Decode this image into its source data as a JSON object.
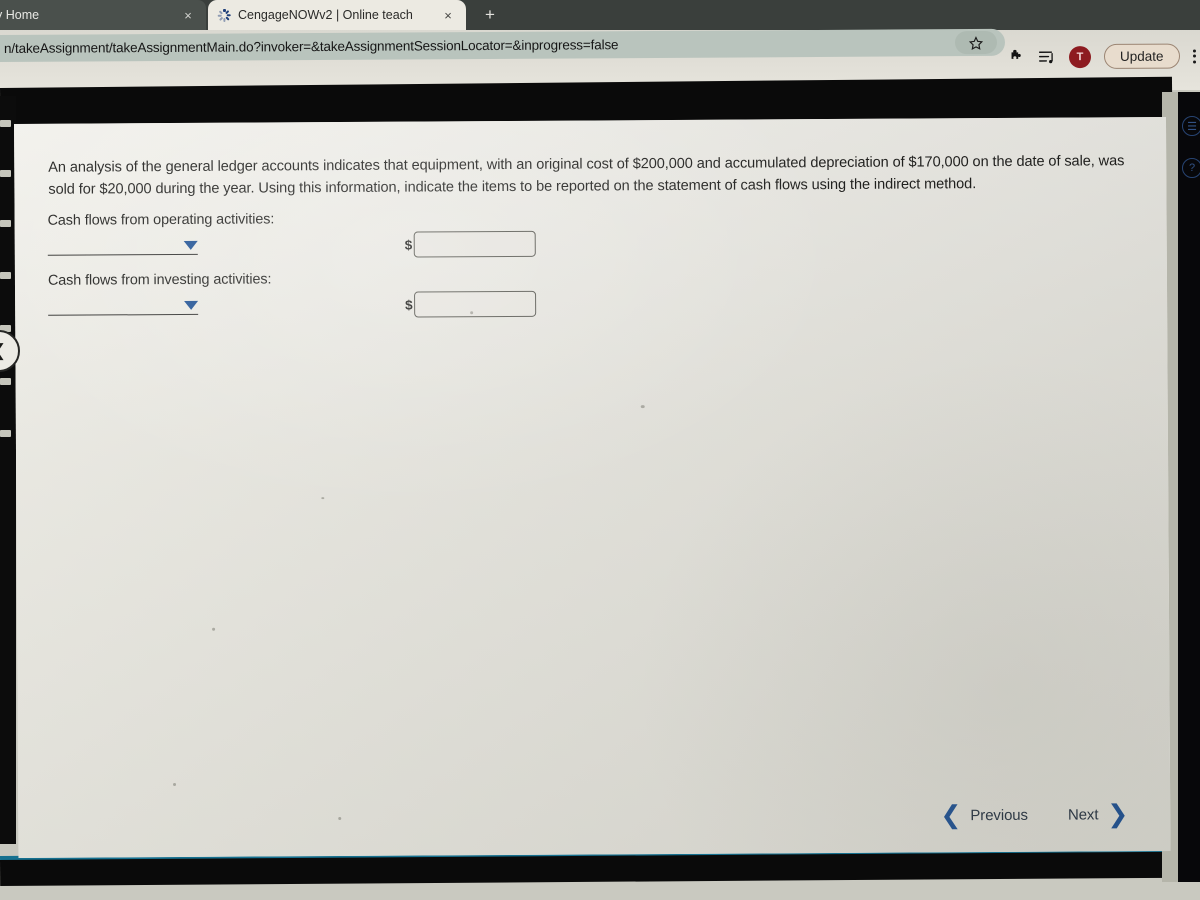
{
  "browser": {
    "tabs": [
      {
        "title": "y Home",
        "active": false,
        "close_label": "×",
        "loading": false
      },
      {
        "title": "CengageNOWv2 | Online teach",
        "active": true,
        "close_label": "×",
        "loading": true
      }
    ],
    "new_tab_label": "+",
    "url": "n/takeAssignment/takeAssignmentMain.do?invoker=&takeAssignmentSessionLocator=&inprogress=false",
    "bookmark_icon": "star-icon",
    "extensions_icon": "puzzle-piece-icon",
    "media_icon": "media-playlist-icon",
    "profile_initial": "T",
    "update_label": "Update",
    "menu_icon": "kebab-menu-icon",
    "accent_blue": "#1b4f93",
    "avatar_color": "#8d1b20"
  },
  "question": {
    "text": "An analysis of the general ledger accounts indicates that equipment, with an original cost of $200,000 and accumulated depreciation of $170,000 on the date of sale, was sold for $20,000 during the year. Using this information, indicate the items to be reported on the statement of cash flows using the indirect method.",
    "original_cost": "$200,000",
    "accumulated_depreciation": "$170,000",
    "sale_price": "$20,000",
    "method": "indirect method"
  },
  "sections": [
    {
      "label": "Cash flows from operating activities:",
      "select_value": "",
      "select_icon": "chevron-down-icon",
      "currency_symbol": "$",
      "amount_value": "",
      "amount_placeholder": ""
    },
    {
      "label": "Cash flows from investing activities:",
      "select_value": "",
      "select_icon": "chevron-down-icon",
      "currency_symbol": "$",
      "amount_value": "",
      "amount_placeholder": ""
    }
  ],
  "navigation": {
    "previous_label": "Previous",
    "next_label": "Next",
    "previous_icon": "chevron-left-icon",
    "next_icon": "chevron-right-icon",
    "prev_chevron": "❮",
    "next_chevron": "❯"
  },
  "collapse_button": {
    "icon": "chevron-left-icon",
    "glyph": "❮"
  },
  "right_rail": {
    "glyphs": [
      "☰",
      "?"
    ]
  }
}
